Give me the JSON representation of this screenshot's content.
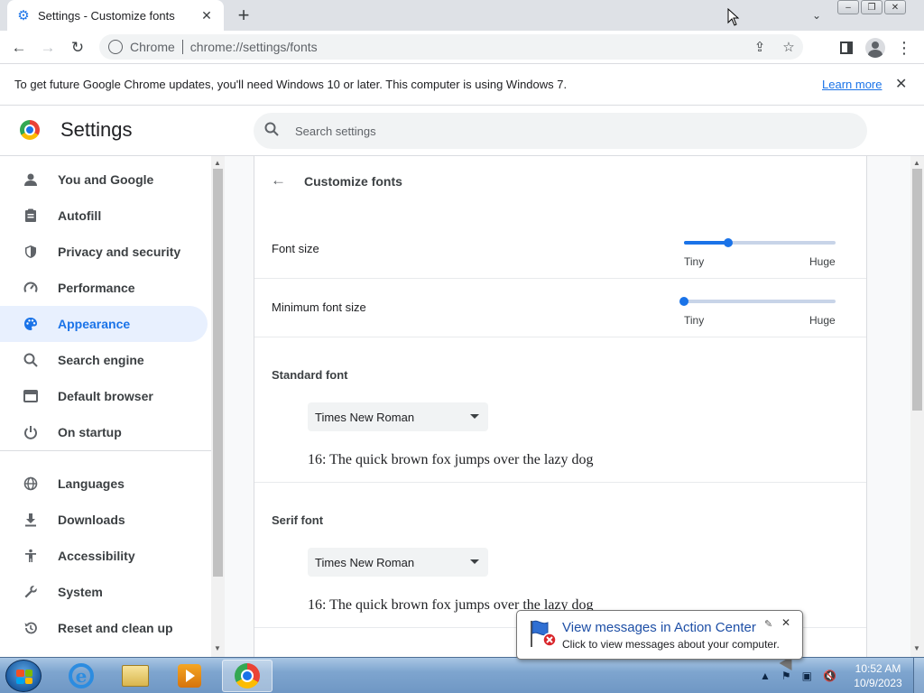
{
  "tab": {
    "title": "Settings - Customize fonts",
    "close": "✕",
    "favicon": "gear-icon"
  },
  "newtab": "+",
  "toolbar": {
    "chip": "Chrome",
    "url": "chrome://settings/fonts"
  },
  "infobar": {
    "message": "To get future Google Chrome updates, you'll need Windows 10 or later. This computer is using Windows 7.",
    "learn_more": "Learn more",
    "close": "✕"
  },
  "settings": {
    "title": "Settings",
    "search_placeholder": "Search settings"
  },
  "sidebar": {
    "items": [
      {
        "label": "You and Google",
        "icon": "person-icon",
        "active": false
      },
      {
        "label": "Autofill",
        "icon": "clipboard-icon",
        "active": false
      },
      {
        "label": "Privacy and security",
        "icon": "shield-icon",
        "active": false
      },
      {
        "label": "Performance",
        "icon": "gauge-icon",
        "active": false
      },
      {
        "label": "Appearance",
        "icon": "palette-icon",
        "active": true
      },
      {
        "label": "Search engine",
        "icon": "search-icon",
        "active": false
      },
      {
        "label": "Default browser",
        "icon": "browser-icon",
        "active": false
      },
      {
        "label": "On startup",
        "icon": "power-icon",
        "active": false
      },
      {
        "label": "Languages",
        "icon": "globe-icon",
        "active": false
      },
      {
        "label": "Downloads",
        "icon": "download-icon",
        "active": false
      },
      {
        "label": "Accessibility",
        "icon": "accessibility-icon",
        "active": false
      },
      {
        "label": "System",
        "icon": "wrench-icon",
        "active": false
      },
      {
        "label": "Reset and clean up",
        "icon": "history-icon",
        "active": false
      }
    ]
  },
  "fonts_page": {
    "title": "Customize fonts",
    "font_size": {
      "label": "Font size",
      "min_label": "Tiny",
      "max_label": "Huge",
      "value_fraction": 0.29
    },
    "min_font_size": {
      "label": "Minimum font size",
      "min_label": "Tiny",
      "max_label": "Huge",
      "value_fraction": 0.0
    },
    "standard_font": {
      "label": "Standard font",
      "value": "Times New Roman",
      "sample": "16: The quick brown fox jumps over the lazy dog"
    },
    "serif_font": {
      "label": "Serif font",
      "value": "Times New Roman",
      "sample": "16: The quick brown fox jumps over the lazy dog"
    }
  },
  "balloon": {
    "title": "View messages in Action Center",
    "text": "Click to view messages about your computer."
  },
  "clock": {
    "time": "10:52 AM",
    "date": "10/9/2023"
  },
  "colors": {
    "accent": "#1a73e8",
    "active_bg": "#e8f0fe"
  }
}
